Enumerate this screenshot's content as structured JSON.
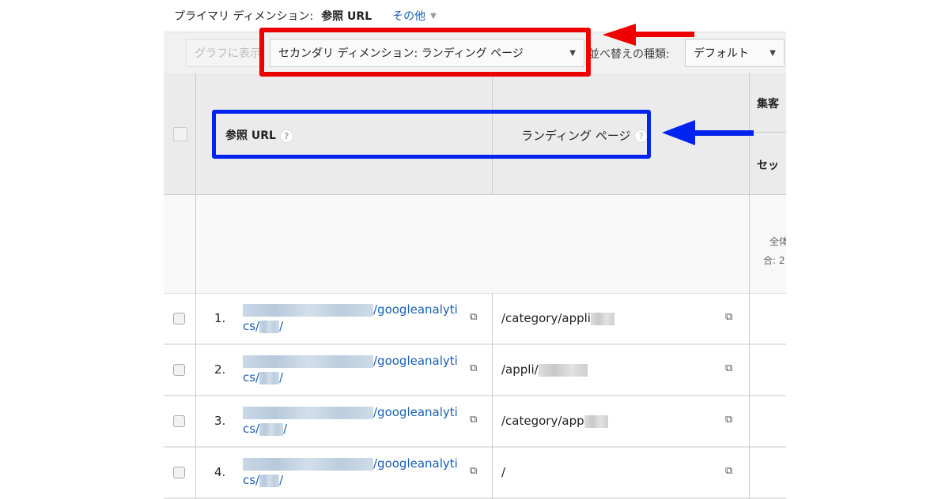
{
  "primary_dimension": {
    "label": "プライマリ ディメンション:",
    "value": "参照 URL",
    "more": "その他"
  },
  "toolbar": {
    "graph_label": "グラフに表示",
    "secondary_label": "セカンダリ ディメンション: ランディング ページ",
    "sort_label": "並べ替えの種類:",
    "sort_value": "デフォルト"
  },
  "table": {
    "headers": {
      "ref_url": "参照 URL",
      "landing_page": "ランディング ページ",
      "group": "集客",
      "sessions": "セッ",
      "help": "?"
    },
    "totals": {
      "line1": "全体",
      "line2": "合: 2"
    },
    "rows": [
      {
        "num": "1.",
        "ref_a": "/googleanalyti",
        "ref_b": "cs/",
        "ref_c": "/",
        "landing": "/category/appli"
      },
      {
        "num": "2.",
        "ref_a": "/googleanalyti",
        "ref_b": "cs/",
        "ref_c": "/",
        "landing": "/appli/"
      },
      {
        "num": "3.",
        "ref_a": "/googleanalyti",
        "ref_b": "cs/",
        "ref_c": "/",
        "landing": "/category/app"
      },
      {
        "num": "4.",
        "ref_a": "/googleanalyti",
        "ref_b": "cs/",
        "ref_c": "/",
        "landing": "/"
      }
    ]
  },
  "annotations": {
    "red": "#e00000",
    "blue": "#0022ee"
  }
}
